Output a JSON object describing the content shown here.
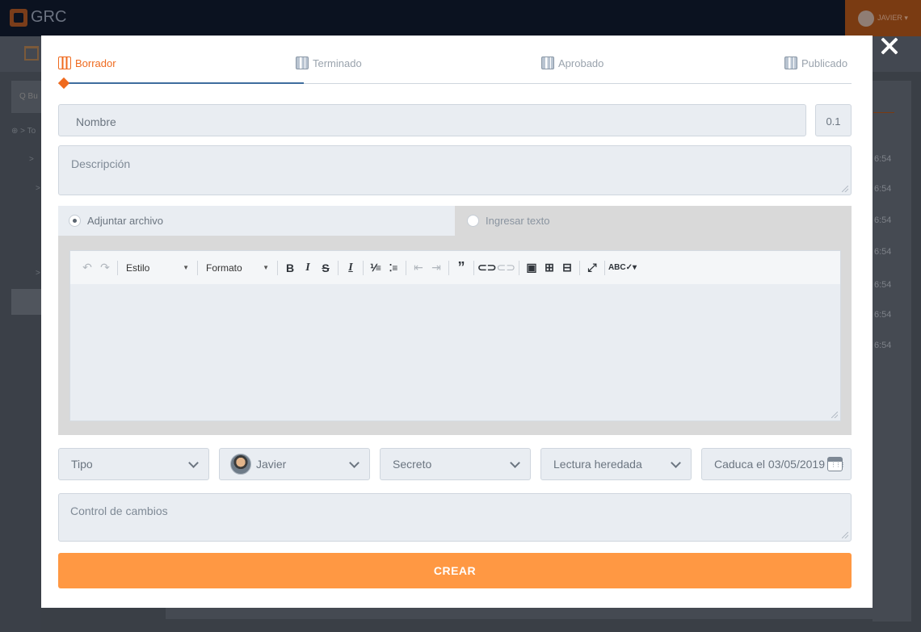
{
  "app": {
    "brand": "GRC",
    "user_label": "JAVIER ▾"
  },
  "background": {
    "search_stub": "Q Bu",
    "tree_root": "⊕ > To",
    "times": [
      "6:54",
      "6:54",
      "6:54",
      "6:54",
      "6:54",
      "6:54",
      "6:54"
    ]
  },
  "steps": [
    {
      "label": "Borrador",
      "active": true
    },
    {
      "label": "Terminado",
      "active": false
    },
    {
      "label": "Aprobado",
      "active": false
    },
    {
      "label": "Publicado",
      "active": false
    }
  ],
  "form": {
    "name_placeholder": "Nombre",
    "version": "0.1",
    "description_placeholder": "Descripción",
    "radio_attach": "Adjuntar archivo",
    "radio_text": "Ingresar texto",
    "attach_selected": true,
    "editor": {
      "style_label": "Estilo",
      "format_label": "Formato"
    },
    "type_placeholder": "Tipo",
    "owner": "Javier",
    "confidentiality": "Secreto",
    "read_access": "Lectura heredada",
    "expires": "Caduca el 03/05/2019",
    "changes_placeholder": "Control de cambios",
    "submit_label": "CREAR"
  },
  "colors": {
    "accent": "#ef6a1e",
    "submit": "#ff9843",
    "progress": "#3e6d9e",
    "field_bg": "#e9edf2"
  }
}
